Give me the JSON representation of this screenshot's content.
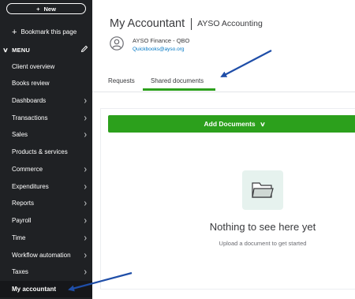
{
  "sidebar": {
    "new_label": "New",
    "new_icon": "plus-icon",
    "bookmark_label": "Bookmark this page",
    "menu_label": "MENU",
    "items": [
      {
        "label": "Client overview",
        "has_arrow": false
      },
      {
        "label": "Books review",
        "has_arrow": false
      },
      {
        "label": "Dashboards",
        "has_arrow": true
      },
      {
        "label": "Transactions",
        "has_arrow": true
      },
      {
        "label": "Sales",
        "has_arrow": true
      },
      {
        "label": "Products & services",
        "has_arrow": false
      },
      {
        "label": "Commerce",
        "has_arrow": true
      },
      {
        "label": "Expenditures",
        "has_arrow": true
      },
      {
        "label": "Reports",
        "has_arrow": true
      },
      {
        "label": "Payroll",
        "has_arrow": true
      },
      {
        "label": "Time",
        "has_arrow": true
      },
      {
        "label": "Workflow automation",
        "has_arrow": true
      },
      {
        "label": "Taxes",
        "has_arrow": true
      },
      {
        "label": "My accountant",
        "has_arrow": false,
        "active": true
      }
    ]
  },
  "header": {
    "title": "My Accountant",
    "firm": "AYSO Accounting",
    "account_name": "AYSO Finance - QBO",
    "account_email": "Quickbooks@ayso.org"
  },
  "tabs": [
    {
      "label": "Requests",
      "active": false
    },
    {
      "label": "Shared documents",
      "active": true
    }
  ],
  "main": {
    "add_button_label": "Add Documents",
    "empty_title": "Nothing to see here yet",
    "empty_subtitle": "Upload a document to get started",
    "empty_icon": "folder-icon"
  },
  "colors": {
    "sidebar_bg": "#1f2124",
    "accent_green": "#2ca01c",
    "link_blue": "#0077c5",
    "annotation_arrow": "#1f4ea8"
  }
}
